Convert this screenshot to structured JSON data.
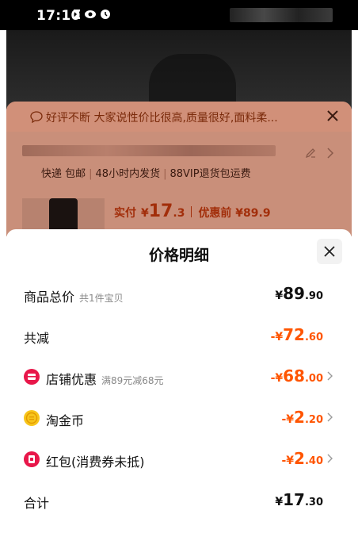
{
  "status_bar": {
    "time": "17:10"
  },
  "background_sheet": {
    "review_banner": "好评不断 大家说性价比很高,质量很好,面料柔...",
    "services": [
      "快递 包邮",
      "48小时内发货",
      "88VIP退货包运费"
    ],
    "price_label": "实付",
    "price_currency": "¥",
    "price_int": "17",
    "price_dec": ".3",
    "price_before": "优惠前 ¥89.9"
  },
  "sheet": {
    "title": "价格明细",
    "rows": [
      {
        "label": "商品总价",
        "sub": "共1件宝贝",
        "sign": "",
        "currency": "¥",
        "int": "89",
        "dec": ".90",
        "style": "plain",
        "icon": ""
      },
      {
        "label": "共减",
        "sub": "",
        "sign": "-",
        "currency": "¥",
        "int": "72",
        "dec": ".60",
        "style": "orange",
        "icon": ""
      },
      {
        "label": "店铺优惠",
        "sub": "满89元减68元",
        "sign": "-",
        "currency": "¥",
        "int": "68",
        "dec": ".00",
        "style": "orange",
        "icon": "shop-coupon-icon"
      },
      {
        "label": "淘金币",
        "sub": "",
        "sign": "-",
        "currency": "¥",
        "int": "2",
        "dec": ".20",
        "style": "orange",
        "icon": "gold-coin-icon"
      },
      {
        "label": "红包(消费券未抵)",
        "sub": "",
        "sign": "-",
        "currency": "¥",
        "int": "2",
        "dec": ".40",
        "style": "orange",
        "icon": "red-packet-icon"
      },
      {
        "label": "合计",
        "sub": "",
        "sign": "",
        "currency": "¥",
        "int": "17",
        "dec": ".30",
        "style": "plain",
        "icon": ""
      }
    ]
  },
  "colors": {
    "orange": "#ff5500",
    "brand_red": "#e8174a",
    "coin_yellow": "#f7c51b"
  }
}
